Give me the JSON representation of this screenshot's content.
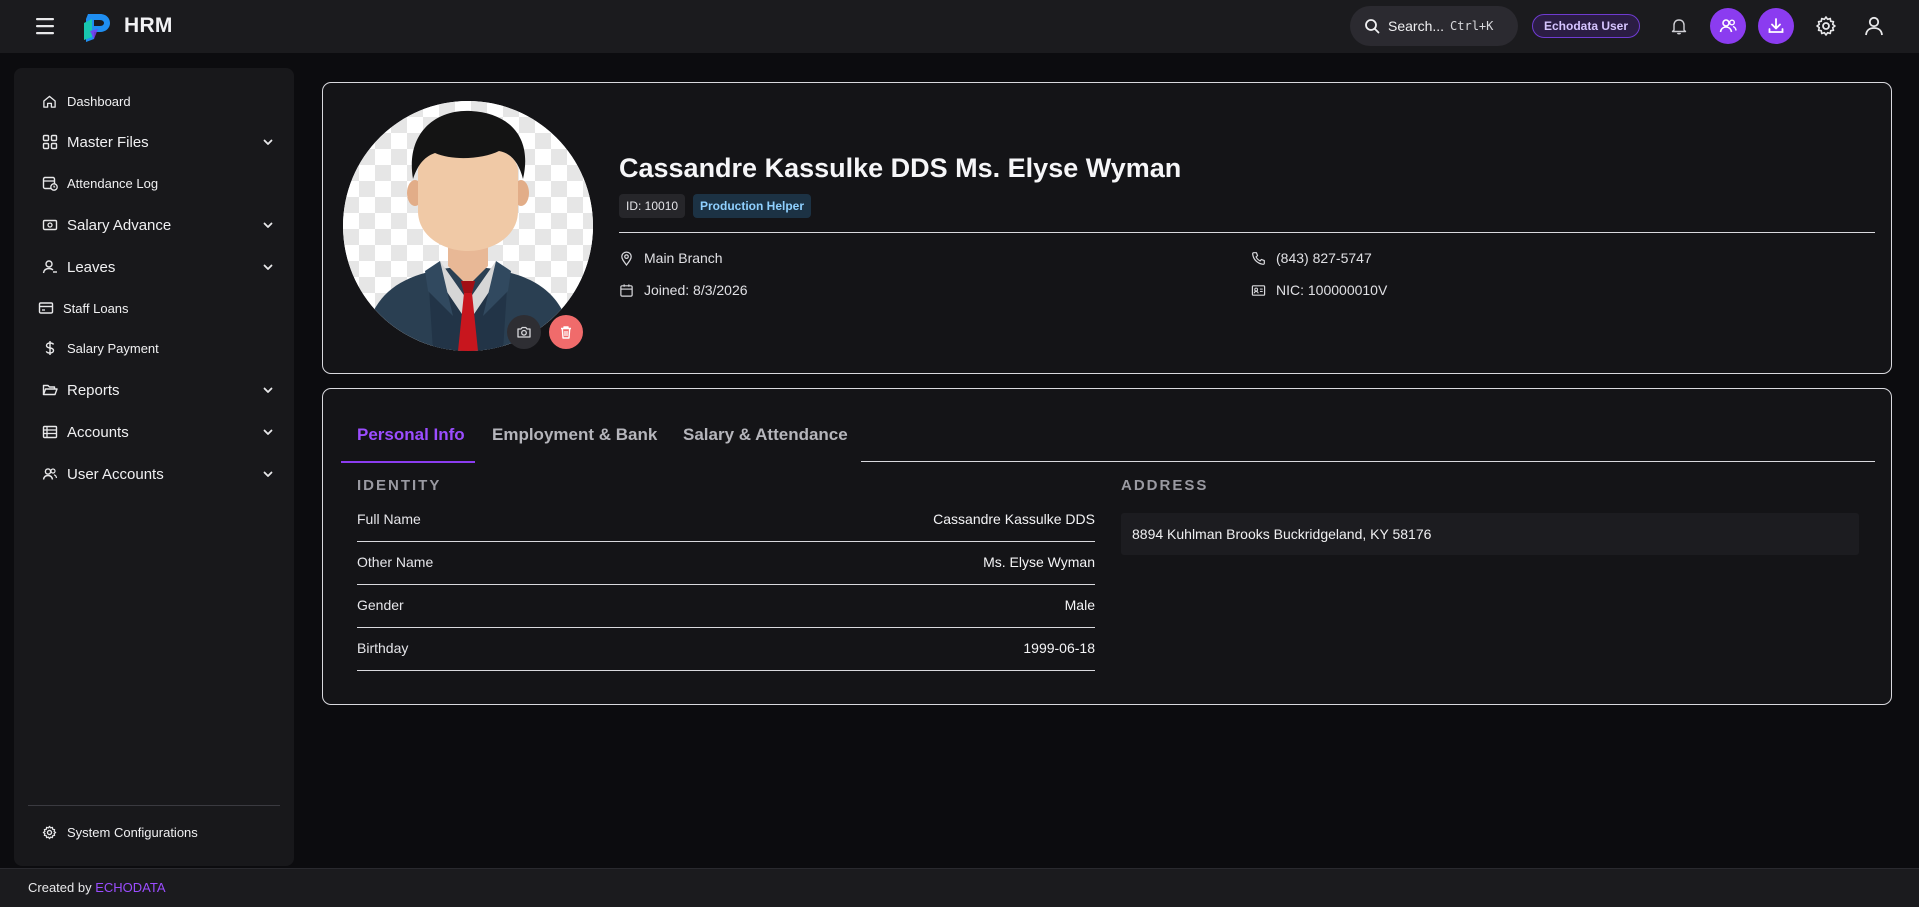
{
  "app": {
    "name": "HRM"
  },
  "topbar": {
    "search_label": "Search...",
    "search_shortcut": "Ctrl+K",
    "user_badge": "Echodata User"
  },
  "sidebar": {
    "items": [
      {
        "label": "Dashboard",
        "icon": "home-icon",
        "expandable": false
      },
      {
        "label": "Master Files",
        "icon": "grid-icon",
        "expandable": true
      },
      {
        "label": "Attendance Log",
        "icon": "calendar-clock-icon",
        "expandable": false
      },
      {
        "label": "Salary Advance",
        "icon": "cash-icon",
        "expandable": true
      },
      {
        "label": "Leaves",
        "icon": "user-icon",
        "expandable": true
      },
      {
        "label": "Staff Loans",
        "icon": "card-icon",
        "expandable": false
      },
      {
        "label": "Salary Payment",
        "icon": "dollar-icon",
        "expandable": false
      },
      {
        "label": "Reports",
        "icon": "folder-open-icon",
        "expandable": true
      },
      {
        "label": "Accounts",
        "icon": "ledger-icon",
        "expandable": true
      },
      {
        "label": "User Accounts",
        "icon": "users-icon",
        "expandable": true
      }
    ],
    "system_config": "System Configurations"
  },
  "profile": {
    "name": "Cassandre Kassulke DDS Ms. Elyse Wyman",
    "id_label": "ID: 10010",
    "role": "Production Helper",
    "branch": "Main Branch",
    "joined": "Joined: 8/3/2026",
    "phone": "(843) 827-5747",
    "nic": "NIC: 100000010V"
  },
  "tabs": [
    "Personal Info",
    "Employment & Bank",
    "Salary & Attendance"
  ],
  "active_tab": "Personal Info",
  "identity": {
    "title": "IDENTITY",
    "rows": [
      {
        "key": "Full Name",
        "value": "Cassandre Kassulke DDS"
      },
      {
        "key": "Other Name",
        "value": "Ms. Elyse Wyman"
      },
      {
        "key": "Gender",
        "value": "Male"
      },
      {
        "key": "Birthday",
        "value": "1999-06-18"
      }
    ]
  },
  "address": {
    "title": "ADDRESS",
    "value": "8894 Kuhlman Brooks Buckridgeland, KY 58176"
  },
  "footer": {
    "prefix": "Created by",
    "brand": "ECHODATA"
  },
  "colors": {
    "accent": "#8b3cf0",
    "danger": "#f06b6b",
    "background": "#0c0c0f"
  }
}
